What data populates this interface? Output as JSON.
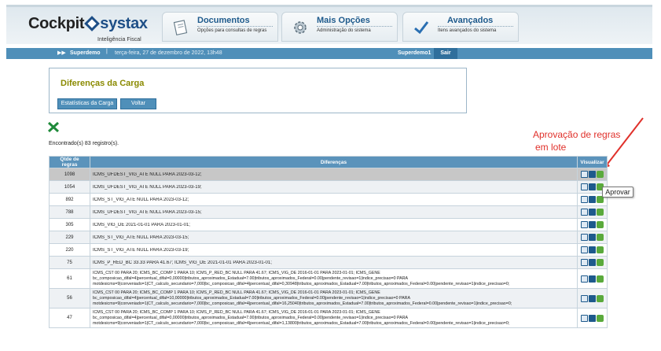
{
  "header": {
    "logo_left": "Cockpit",
    "logo_right": "systax",
    "logo_sub": "Inteligência Fiscal",
    "tabs": [
      {
        "title": "Documentos",
        "subtitle": "Opções para consultas de regras",
        "icon": "document-icon"
      },
      {
        "title": "Mais Opções",
        "subtitle": "Administração do sistema",
        "icon": "gear-icon"
      },
      {
        "title": "Avançados",
        "subtitle": "Itens avançados do sistema",
        "icon": "checkmark-icon"
      }
    ]
  },
  "infobar": {
    "arrows": "▶▶",
    "user": "Superdemo",
    "separator": "|",
    "date": "terça-feira, 27 de dezembro de 2022, 13h48",
    "user_right": "Superdemo1",
    "logout": "Sair"
  },
  "panel": {
    "title": "Diferenças da Carga",
    "btn_stats": "Estatísticas da Carga",
    "btn_back": "Voltar"
  },
  "found_text": "Encontrado(s) 83 registro(s).",
  "annotation": {
    "line1": "Aprovação de regras",
    "line2": "em lote",
    "color": "#e0302a"
  },
  "tooltip": "Aprovar",
  "table": {
    "headers": [
      "Qtde de regras",
      "Diferenças",
      "Visualizar"
    ],
    "rows": [
      {
        "qtd": "1098",
        "diff": [
          "ICMS_UFDEST_VIG_ATE NULL PARA 2023-03-12;"
        ]
      },
      {
        "qtd": "1054",
        "diff": [
          "ICMS_UFDEST_VIG_ATE NULL PARA 2023-03-19;"
        ]
      },
      {
        "qtd": "892",
        "diff": [
          "ICMS_ST_VIG_ATE NULL PARA 2023-03-12;"
        ]
      },
      {
        "qtd": "788",
        "diff": [
          "ICMS_UFDEST_VIG_ATE NULL PARA 2023-03-15;"
        ]
      },
      {
        "qtd": "305",
        "diff": [
          "ICMS_VIG_DE 2021-01-01 PARA 2023-01-01;"
        ]
      },
      {
        "qtd": "229",
        "diff": [
          "ICMS_ST_VIG_ATE NULL PARA 2023-03-15;"
        ]
      },
      {
        "qtd": "220",
        "diff": [
          "ICMS_ST_VIG_ATE NULL PARA 2023-03-19;"
        ]
      },
      {
        "qtd": "75",
        "diff": [
          "ICMS_P_RED_BC 33.33 PARA 41.67; ICMS_VIG_DE 2021-01-01 PARA 2023-01-01;"
        ]
      },
      {
        "qtd": "61",
        "diff": [
          "ICMS_CST 00 PARA 20; ICMS_BC_COMP 1 PARA 10; ICMS_P_RED_BC NULL PARA 41.67; ICMS_VIG_DE 2016-01-01 PARA 2023-01-01; ICMS_GENE",
          "bc_composicao_difal=4|percentual_difal=0,00000|tributos_aproximados_Estadual=7.00|tributos_aproximados_Federal=0.00|pendente_revisao=1|indice_precisao=0 PARA",
          "motdesicms=9|conveniado=1|CT_calculo_secundario=7,000|bc_composicao_difal=4|percentual_difal=0,30948|tributos_aproximados_Estadual=7.00|tributos_aproximados_Federal=0.00|pendente_revisao=1|indice_precisao=0;"
        ]
      },
      {
        "qtd": "56",
        "diff": [
          "ICMS_CST 00 PARA 20; ICMS_BC_COMP 1 PARA 10; ICMS_P_RED_BC NULL PARA 41.67; ICMS_VIG_DE 2016-01-01 PARA 2023-01-01; ICMS_GENE",
          "bc_composicao_difal=4|percentual_difal=10,00000|tributos_aproximados_Estadual=7.00|tributos_aproximados_Federal=0.00|pendente_revisao=1|indice_precisao=0 PARA",
          "motdesicms=9|conveniado=1|CT_calculo_secundario=7,000|bc_composicao_difal=4|percentual_difal=16,25040|tributos_aproximados_Estadual=7.00|tributos_aproximados_Federal=0.00|pendente_revisao=1|indice_precisao=0;"
        ]
      },
      {
        "qtd": "47",
        "diff": [
          "ICMS_CST 00 PARA 20; ICMS_BC_COMP 1 PARA 10; ICMS_P_RED_BC NULL PARA 41.67; ICMS_VIG_DE 2016-01-01 PARA 2023-01-01; ICMS_GENE",
          "bc_composicao_difal=4|percentual_difal=0,00000|tributos_aproximados_Estadual=7.00|tributos_aproximados_Federal=0.00|pendente_revisao=1|indice_precisao=0 PARA",
          "motdesicms=9|conveniado=1|CT_calculo_secundario=7,000|bc_composicao_difal=4|percentual_difal=1,13800|tributos_aproximados_Estadual=7.00|tributos_aproximados_Federal=0.00|pendente_revisao=1|indice_precisao=0;"
        ]
      }
    ]
  }
}
